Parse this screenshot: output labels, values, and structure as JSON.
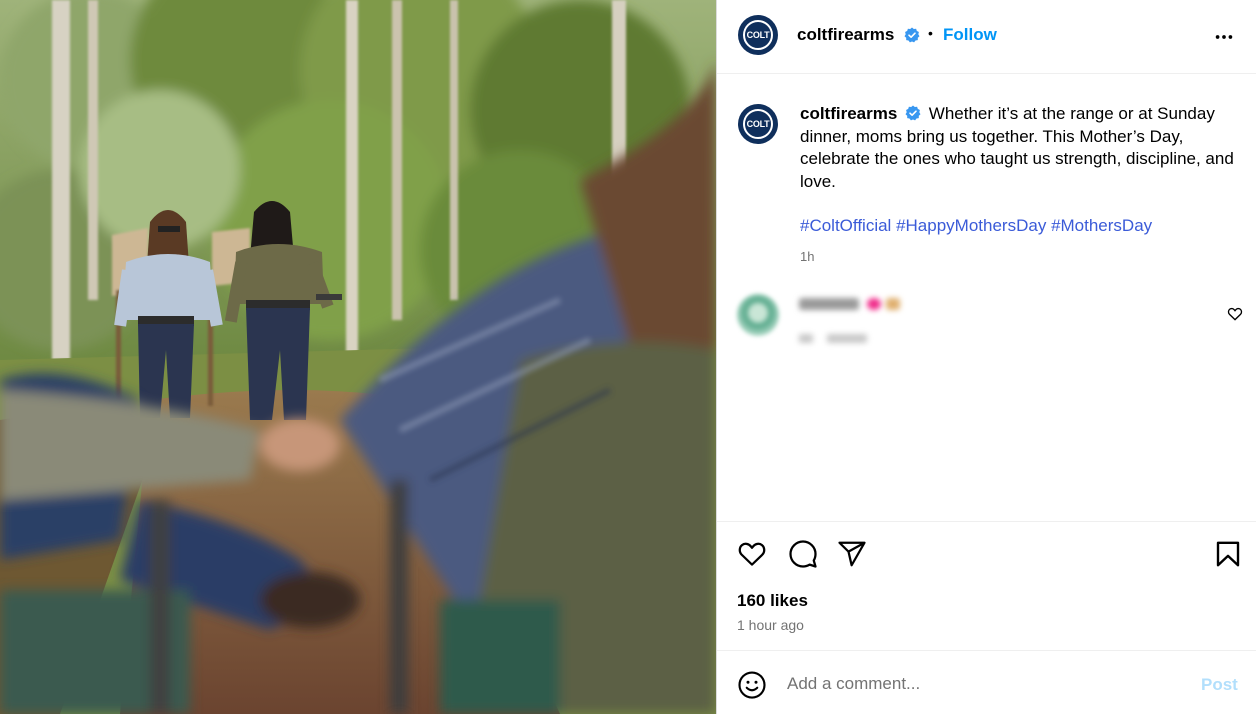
{
  "post": {
    "image_alt": "",
    "account": {
      "username": "coltfirearms",
      "avatar_text": "COLT",
      "verified": true
    },
    "header": {
      "separator": "•",
      "follow_label": "Follow",
      "more_icon": "more-horizontal-icon"
    },
    "caption": {
      "text": "Whether it’s at the range or at Sunday dinner, moms bring us together. This Mother’s Day, celebrate the ones who taught us strength, discipline, and love.",
      "hashtags": [
        "#ColtOfficial",
        "#HappyMothersDay",
        "#MothersDay"
      ],
      "time": "1h"
    },
    "comments": [
      {
        "username": "",
        "text": "",
        "time": "",
        "reply_label": ""
      }
    ],
    "actions": {
      "like_icon": "heart-icon",
      "comment_icon": "comment-bubble-icon",
      "share_icon": "paper-plane-icon",
      "save_icon": "bookmark-icon",
      "likes": "160 likes",
      "time": "1 hour ago"
    },
    "comment_box": {
      "placeholder": "Add a comment...",
      "post_label": "Post",
      "emoji_icon": "smiley-icon"
    }
  },
  "colors": {
    "link": "#0095f6",
    "hashtag": "#3b5bd8",
    "verified": "#3897f0",
    "muted": "#737373",
    "brand_blue": "#0f2f5c",
    "post_disabled": "#b2dffc"
  }
}
